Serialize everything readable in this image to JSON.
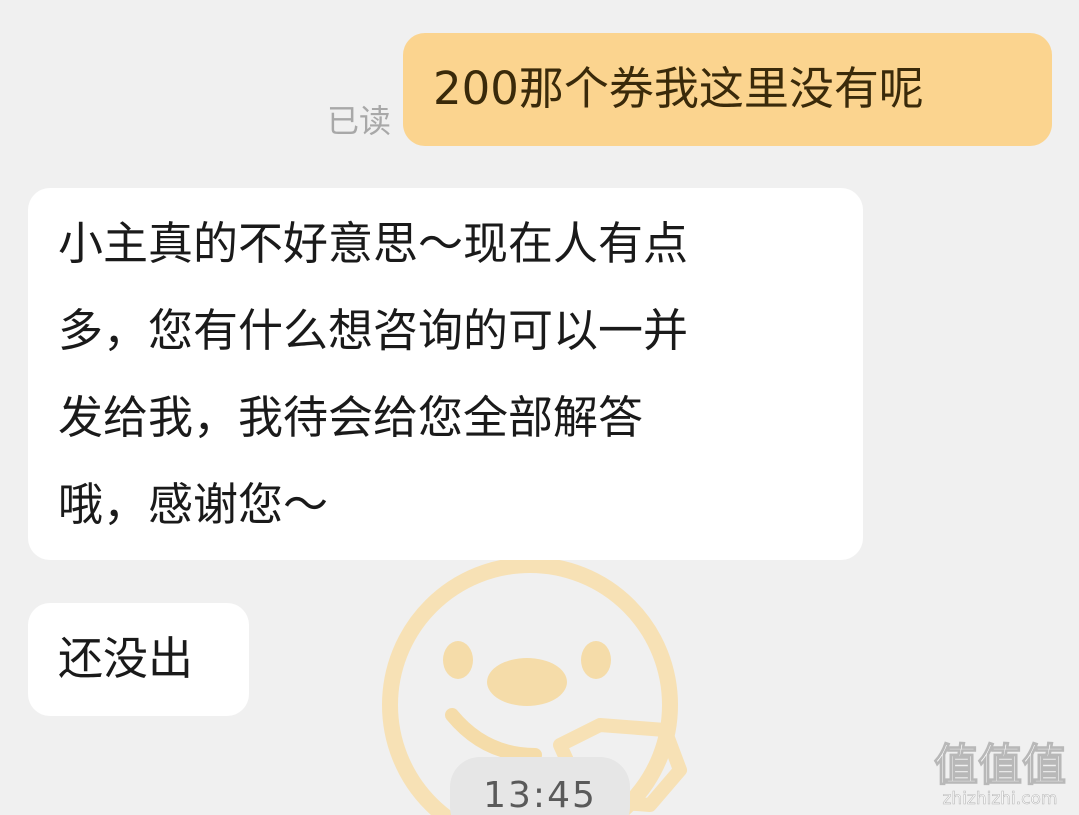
{
  "messages": {
    "sent_1": {
      "text": "200那个券我这里没有呢",
      "status": "已读"
    },
    "received_1": {
      "lines": [
        "小主真的不好意思～现在人有点",
        "多，您有什么想咨询的可以一并",
        "发给我，我待会给您全部解答",
        "哦，感谢您～"
      ]
    },
    "received_2": {
      "text": "还没出"
    }
  },
  "timestamp": "13:45",
  "watermark": {
    "logo_text": "值值值",
    "domain": "zhizhizhi.com"
  },
  "colors": {
    "background": "#f0f0f0",
    "sent_bubble": "#fbd48f",
    "received_bubble": "#ffffff",
    "mascot": "#f3c77a"
  },
  "icons": {
    "mascot": "smiling-chick-watermark-icon"
  }
}
